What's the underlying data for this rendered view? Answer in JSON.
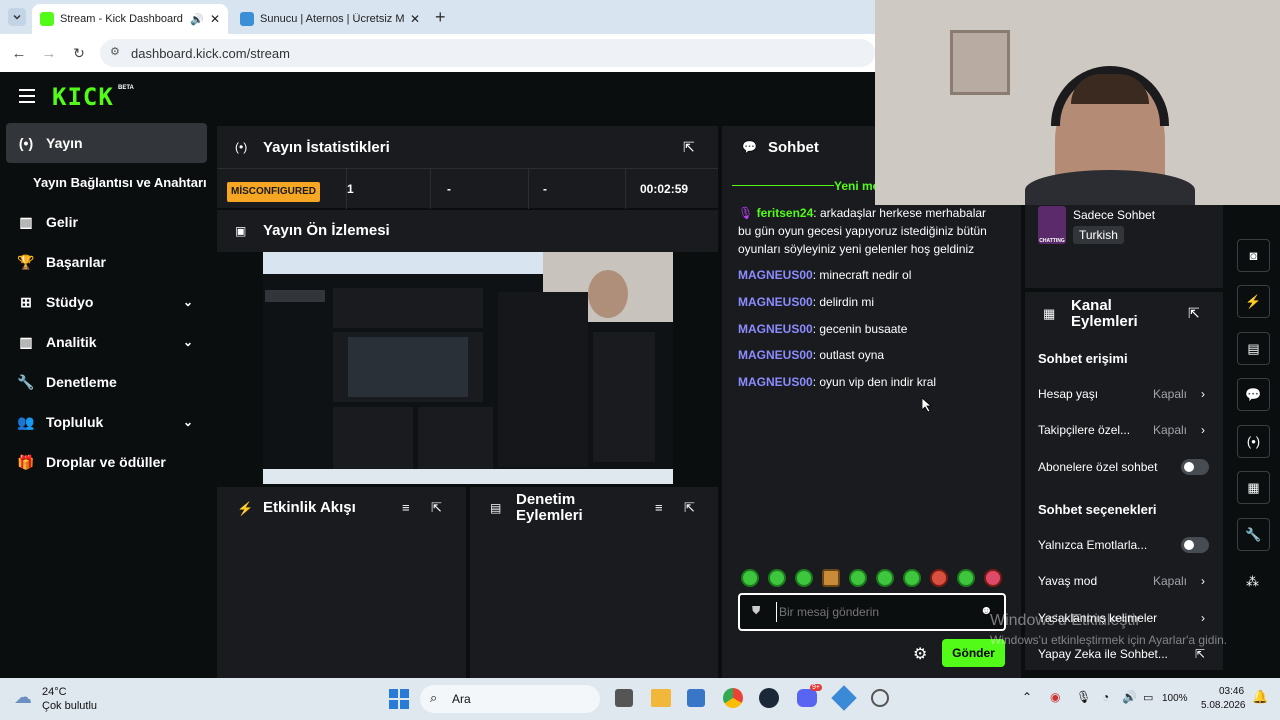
{
  "browser": {
    "tabs": [
      {
        "title": "Stream - Kick Dashboard"
      },
      {
        "title": "Sunucu | Aternos | Ücretsiz Min"
      }
    ],
    "new_tab": "+",
    "url": "dashboard.kick.com/stream"
  },
  "kick": {
    "logo": "KICK",
    "beta": "BETA",
    "nav": [
      {
        "label": "Yayın",
        "icon": "broadcast-icon"
      },
      {
        "label": "Yayın Bağlantısı ve Anahtarı",
        "icon": ""
      },
      {
        "label": "Gelir",
        "icon": "chart-icon"
      },
      {
        "label": "Başarılar",
        "icon": "trophy-icon"
      },
      {
        "label": "Stüdyo",
        "icon": "grid-icon"
      },
      {
        "label": "Analitik",
        "icon": "chart-icon"
      },
      {
        "label": "Denetleme",
        "icon": "wrench-icon"
      },
      {
        "label": "Topluluk",
        "icon": "users-icon"
      },
      {
        "label": "Droplar ve ödüller",
        "icon": "gift-icon"
      }
    ],
    "stats": {
      "title": "Yayın İstatistikleri",
      "status": "MİSCONFIGURED",
      "viewers": "1",
      "followers": "-",
      "subs": "-",
      "duration": "00:02:59"
    },
    "preview": {
      "title": "Yayın Ön İzlemesi"
    },
    "activity": {
      "title": "Etkinlik Akışı"
    },
    "modactions": {
      "title_line1": "Denetim",
      "title_line2": "Eylemleri"
    },
    "chat": {
      "title": "Sohbet",
      "new_marker": "Yeni me",
      "messages": [
        {
          "user": "feritsen24",
          "text": ": arkadaşlar herkese merhabalar bu gün oyun gecesi yapıyoruz istediğiniz bütün oyunları söyleyiniz yeni gelenler hoş geldiniz"
        },
        {
          "user": "MAGNEUS00",
          "text": ": minecraft nedir ol"
        },
        {
          "user": "MAGNEUS00",
          "text": ": delirdin mi"
        },
        {
          "user": "MAGNEUS00",
          "text": ": gecenin busaate"
        },
        {
          "user": "MAGNEUS00",
          "text": ": outlast oyna"
        },
        {
          "user": "MAGNEUS00",
          "text": ": oyun vip den indir kral"
        }
      ],
      "input_placeholder": "Bir mesaj gönderin",
      "send_label": "Gönder"
    },
    "streaminfo": {
      "chat_mode": "Sadece Sohbet",
      "language": "Turkish",
      "badge": "CHATTING"
    },
    "channel_actions": {
      "title_line1": "Kanal",
      "title_line2": "Eylemleri",
      "chat_access": "Sohbet erişimi",
      "account_age": {
        "label": "Hesap yaşı",
        "value": "Kapalı"
      },
      "followers_only": {
        "label": "Takipçilere özel...",
        "value": "Kapalı"
      },
      "subs_only": {
        "label": "Abonelere özel sohbet"
      },
      "chat_options": "Sohbet seçenekleri",
      "emote_only": {
        "label": "Yalnızca Emotlarla..."
      },
      "slow_mode": {
        "label": "Yavaş mod",
        "value": "Kapalı"
      },
      "banned_words": {
        "label": "Yasaklanmış kelimeler"
      },
      "ai_mod": {
        "label": "Yapay Zeka ile Sohbet..."
      }
    }
  },
  "watermark": {
    "line1": "Windows'u Etkinleştir",
    "line2": "Windows'u etkinleştirmek için Ayarlar'a gidin."
  },
  "taskbar": {
    "weather_temp": "24°C",
    "weather_desc": "Çok bulutlu",
    "search": "Ara",
    "battery": "100%",
    "time": "03:46",
    "date": "5.08.2026",
    "discord_badge": "9+"
  },
  "colors": {
    "kick_green": "#53fc18",
    "chat_user": "#8c8cff",
    "status_badge": "#f5a623"
  }
}
